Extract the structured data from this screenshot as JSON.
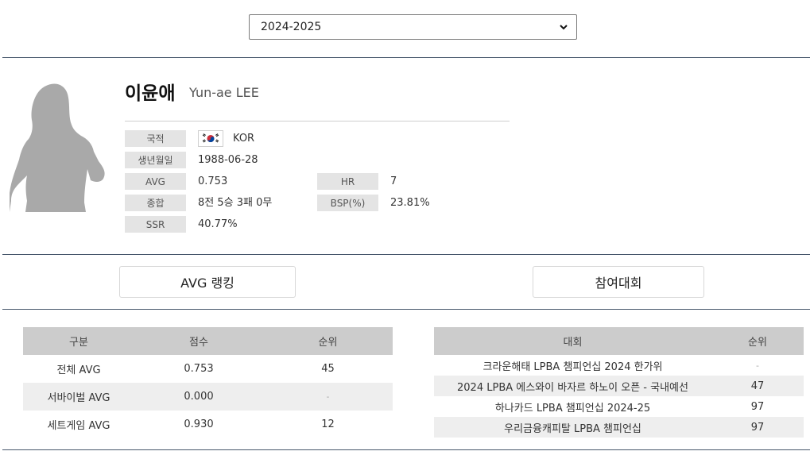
{
  "season_select": {
    "value": "2024-2025"
  },
  "player": {
    "name_ko": "이윤애",
    "name_en": "Yun-ae LEE"
  },
  "info": {
    "nationality_label": "국적",
    "nationality_value": "KOR",
    "birth_label": "생년월일",
    "birth_value": "1988-06-28",
    "avg_label": "AVG",
    "avg_value": "0.753",
    "hr_label": "HR",
    "hr_value": "7",
    "record_label": "종합",
    "record_value": "8전 5승 3패 0무",
    "bsp_label": "BSP(%)",
    "bsp_value": "23.81%",
    "ssr_label": "SSR",
    "ssr_value": "40.77%"
  },
  "tabs": {
    "avg_ranking": "AVG 랭킹",
    "tournaments": "참여대회"
  },
  "ranking_table": {
    "headers": [
      "구분",
      "점수",
      "순위"
    ],
    "rows": [
      [
        "전체 AVG",
        "0.753",
        "45"
      ],
      [
        "서바이벌 AVG",
        "0.000",
        "-"
      ],
      [
        "세트게임 AVG",
        "0.930",
        "12"
      ]
    ]
  },
  "events_table": {
    "headers": [
      "대회",
      "순위"
    ],
    "rows": [
      [
        "크라운해태 LPBA 챔피언십 2024 한가위",
        "-"
      ],
      [
        "2024 LPBA 에스와이 바자르 하노이 오픈 - 국내예선",
        "47"
      ],
      [
        "하나카드 LPBA 챔피언십 2024-25",
        "97"
      ],
      [
        "우리금융캐피탈 LPBA 챔피언십",
        "97"
      ]
    ]
  },
  "colors": {
    "rule": "#46566b",
    "label_bg": "#e4e4e4",
    "table_header_bg": "#cccccc",
    "row_alt_bg": "#eeeeee",
    "silhouette": "#a9a9a9"
  }
}
